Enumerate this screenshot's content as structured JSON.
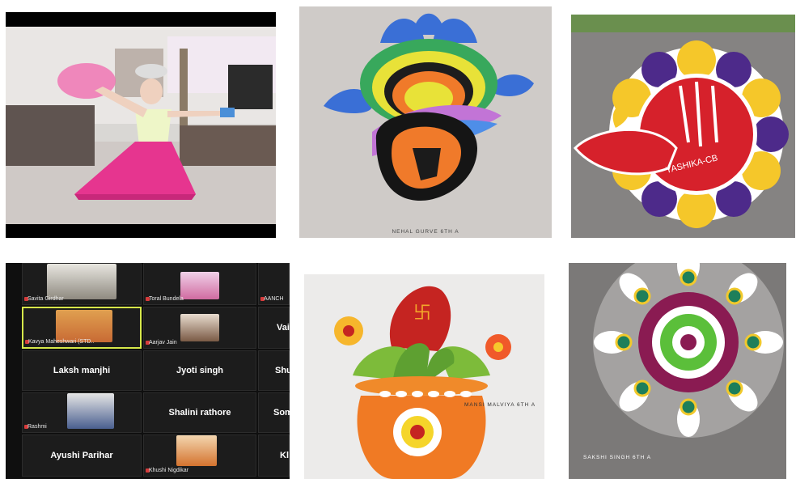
{
  "photos": {
    "dance": {
      "label": "dancer photo"
    },
    "rangoli_nehal": {
      "caption": "NEHAL GURVE 6TH A"
    },
    "rangoli_yashika": {
      "signature": "YASHIKA-CB"
    },
    "rangoli_mansi": {
      "caption": "MANSI MALVIYA 6TH A"
    },
    "rangoli_sakshi": {
      "caption": "SAKSHI SINGH 6TH A"
    }
  },
  "video_call": {
    "participants": [
      {
        "name": "Savita Girdhar",
        "type": "video"
      },
      {
        "name": "Toral Bundela",
        "type": "video"
      },
      {
        "name": "AANCH",
        "type": "cut"
      },
      {
        "name": "Kavya Maheshwari (STD..",
        "type": "video",
        "active": true
      },
      {
        "name": "Aarjav Jain",
        "type": "video"
      },
      {
        "name": "Vais",
        "type": "cut"
      },
      {
        "name": "Laksh manjhi",
        "type": "name"
      },
      {
        "name": "Jyoti singh",
        "type": "name"
      },
      {
        "name": "Shu",
        "type": "cut"
      },
      {
        "name": "Rashmi",
        "type": "video"
      },
      {
        "name": "Shalini rathore",
        "type": "name"
      },
      {
        "name": "Som",
        "type": "cut"
      },
      {
        "name": "Ayushi Parihar",
        "type": "name"
      },
      {
        "name": "Khushi Nigdikar",
        "type": "video"
      },
      {
        "name": "Kl",
        "type": "cut"
      }
    ]
  },
  "colors": {
    "active_border": "#d6e84a",
    "tile_bg": "#1c1c1c",
    "mic_red": "#d63b3b"
  }
}
